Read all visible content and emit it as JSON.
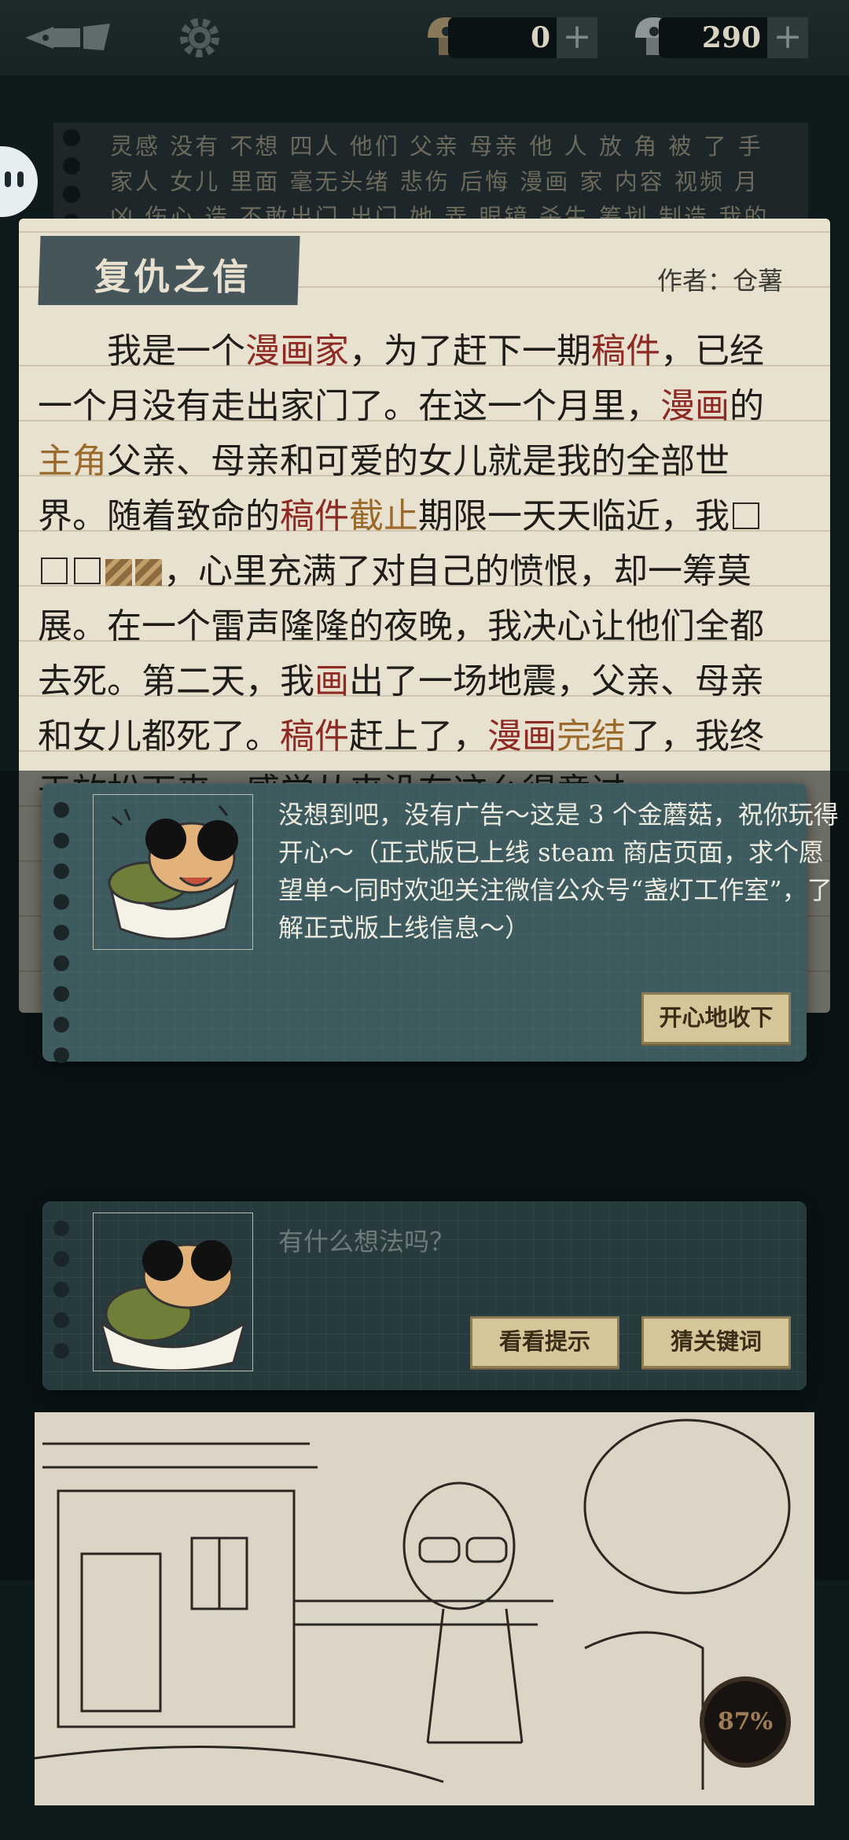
{
  "topbar": {
    "pen_icon": "pen-icon",
    "gear_icon": "gear-icon",
    "gold_mushrooms": {
      "value": "0",
      "plus": "+"
    },
    "silver_mushrooms": {
      "value": "290",
      "plus": "+"
    }
  },
  "background_words": "灵感 没有 不想 四人 他们 父亲 母亲 他 人 放 角 被 了 手 家人 女儿 里面 毫无头绪 悲伤 后悔 漫画 家 内容 视频 月 凶 伤心 造 不敢出门 出门 她 弄 眼镜 杀生 筹划 制造 我的 医生 职业 突然",
  "card": {
    "title": "复仇之信",
    "author": "作者：仓薯",
    "story": {
      "p1": "我是一个",
      "k1": "漫画家",
      "p2": "，为了赶下一期",
      "k2": "稿件",
      "p3": "，已经一个月没有走出家门了。在这一个月里，",
      "k3": "漫画",
      "p4": "的",
      "k4": "主角",
      "p5": "父亲、母亲和可爱的女儿就是我的全部世界。随着致命的",
      "k5": "稿件",
      "k6": "截止",
      "p6": "期限一天天临近，我",
      "p7": "，心里充满了对自己的愤恨，却一筹莫展。在一个雷声隆隆的夜晚，我决心让他们全都去死。第二天，我",
      "k7": "画",
      "p8": "出了一场地震，父亲、母亲和女儿都死了。",
      "k8": "稿件",
      "p9": "赶上了，",
      "k9": "漫画",
      "k10": "完结",
      "p10": "了，我终于放松下来，感觉从来没有这么得意过"
    }
  },
  "reward_dialog": {
    "message": "没想到吧，没有广告～这是 3 个金蘑菇，祝你玩得开心～（正式版已上线 steam 商店页面，求个愿望单～同时欢迎关注微信公众号“盏灯工作室”，了解正式版上线信息～）",
    "accept_button": "开心地收下"
  },
  "input_panel": {
    "placeholder": "有什么想法吗？",
    "hint_button": "看看提示",
    "guess_button": "猜关键词"
  },
  "progress": {
    "label": "87%",
    "value": 0.87
  },
  "colors": {
    "highlight_red": "#8d2a24",
    "highlight_gold": "#9a6a2c",
    "dialog_teal": "#3d5a5e",
    "button_gold": "#d6c79a"
  }
}
